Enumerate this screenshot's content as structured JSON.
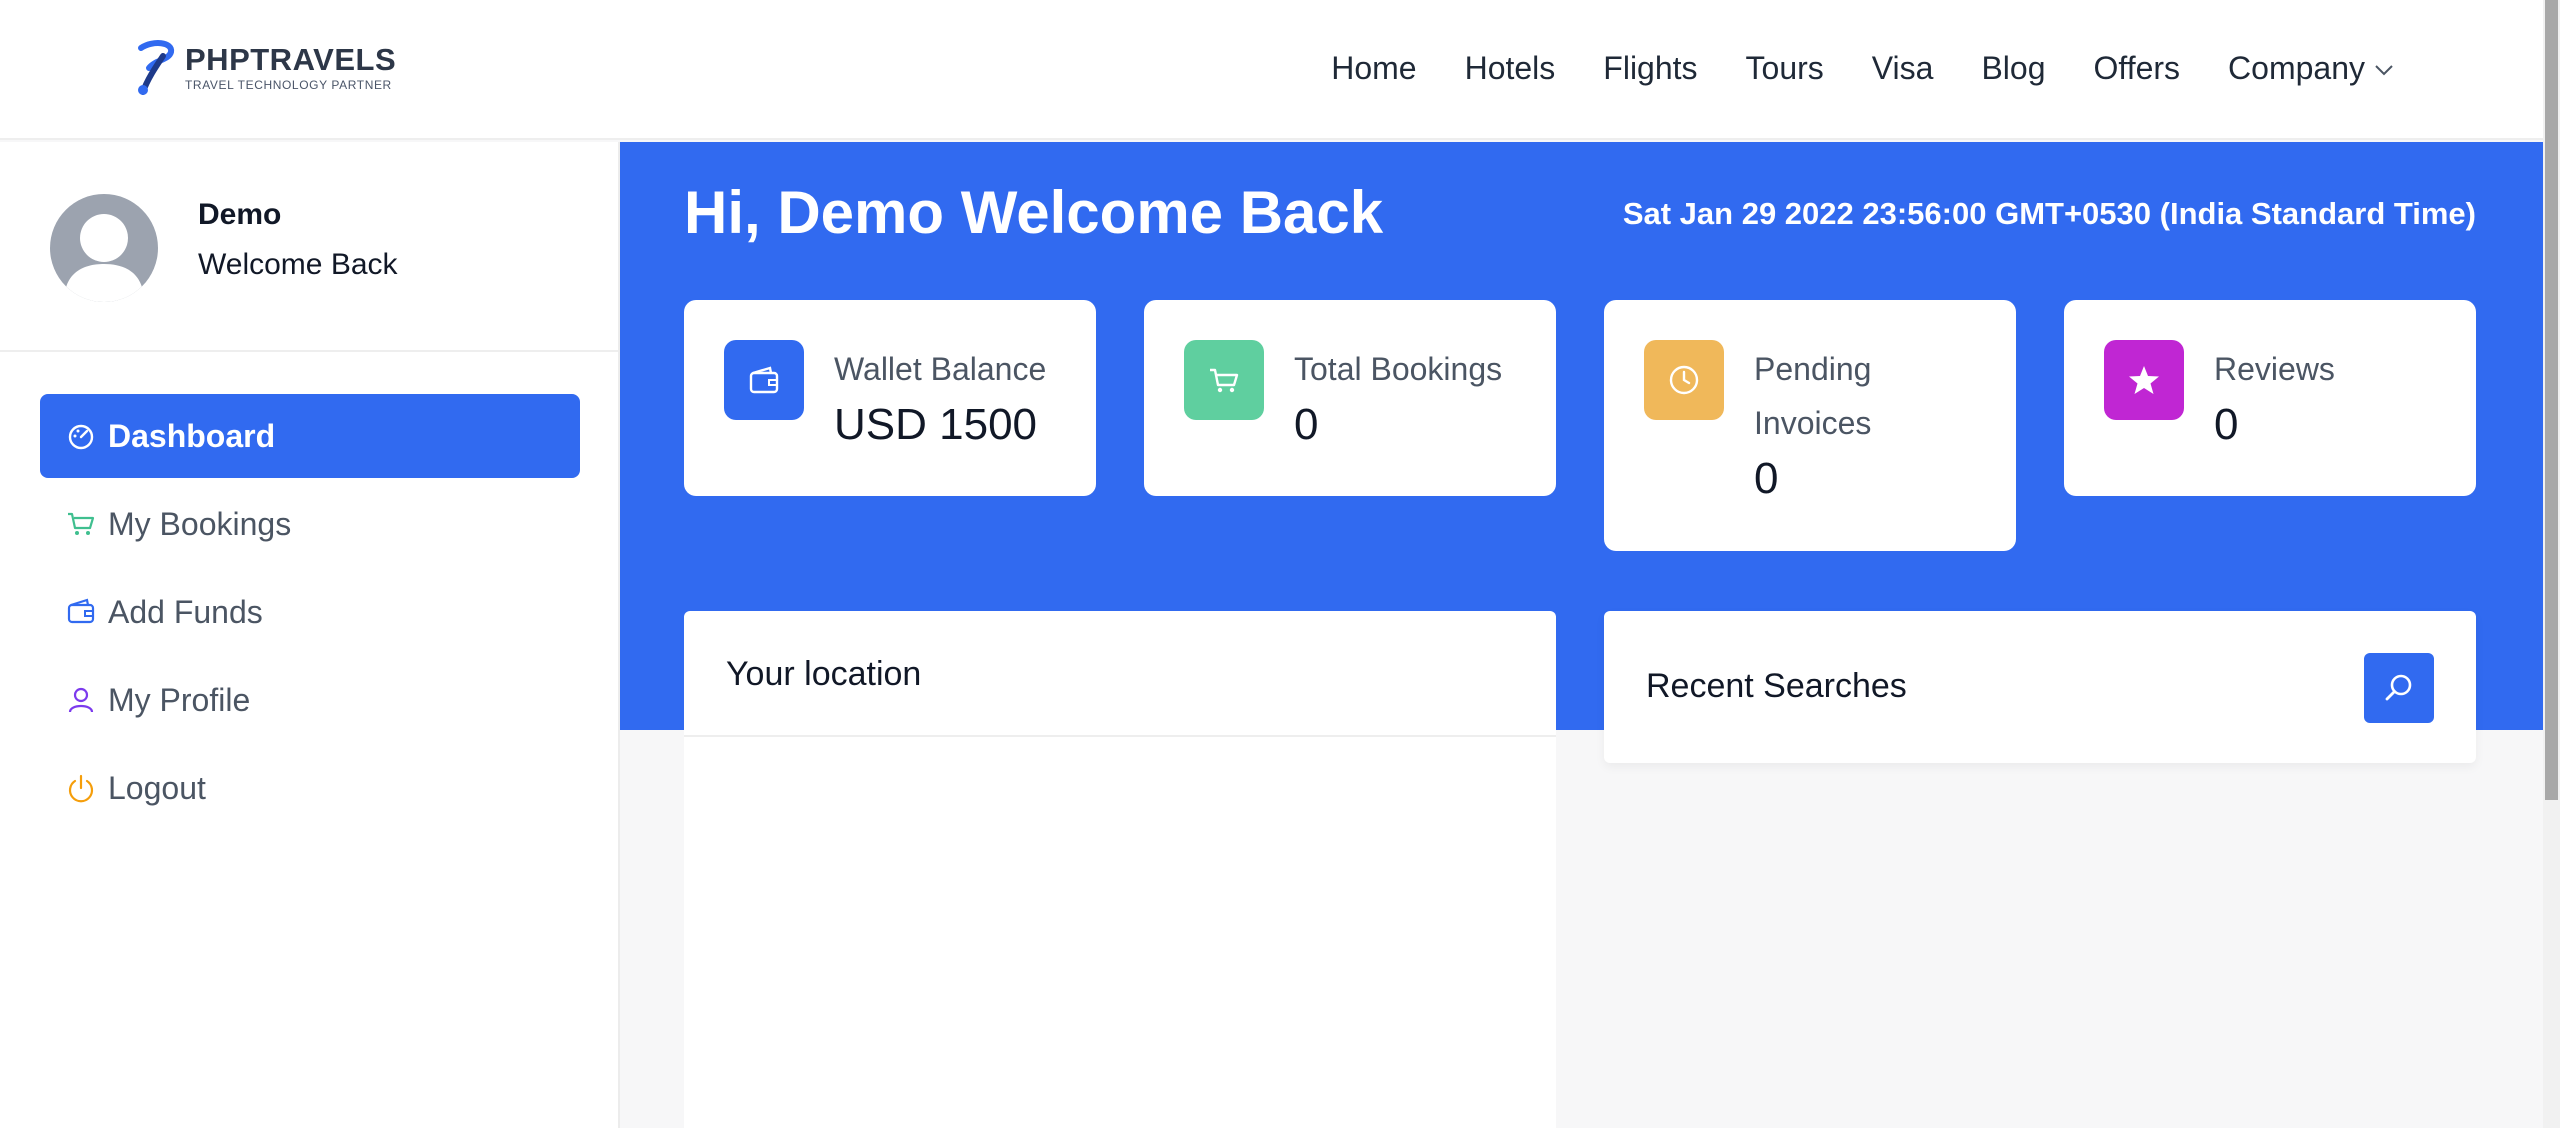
{
  "brand": {
    "name": "PHPTRAVELS",
    "tagline": "TRAVEL TECHNOLOGY PARTNER"
  },
  "nav": [
    "Home",
    "Hotels",
    "Flights",
    "Tours",
    "Visa",
    "Blog",
    "Offers",
    "Company"
  ],
  "profile": {
    "name": "Demo",
    "subtitle": "Welcome Back"
  },
  "menu": [
    {
      "label": "Dashboard",
      "icon": "dashboard-gauge-icon",
      "active": true
    },
    {
      "label": "My Bookings",
      "icon": "cart-icon"
    },
    {
      "label": "Add Funds",
      "icon": "wallet-icon"
    },
    {
      "label": "My Profile",
      "icon": "user-icon"
    },
    {
      "label": "Logout",
      "icon": "power-icon"
    }
  ],
  "main": {
    "greeting": "Hi, Demo Welcome Back",
    "datetime": "Sat Jan 29 2022 23:56:00 GMT+0530 (India Standard Time)"
  },
  "stats": [
    {
      "label": "Wallet Balance",
      "value": "USD 1500",
      "icon": "wallet-icon",
      "color": "#316af0"
    },
    {
      "label": "Total Bookings",
      "value": "0",
      "icon": "cart-icon",
      "color": "#5fcf9f"
    },
    {
      "label": "Pending Invoices",
      "value": "0",
      "icon": "clock-icon",
      "color": "#f0b85a"
    },
    {
      "label": "Reviews",
      "value": "0",
      "icon": "star-icon",
      "color": "#c026d3"
    }
  ],
  "panels": {
    "location_title": "Your location",
    "recent_title": "Recent Searches"
  },
  "colors": {
    "primary": "#316af0",
    "text": "#111827",
    "muted": "#4b5563"
  }
}
